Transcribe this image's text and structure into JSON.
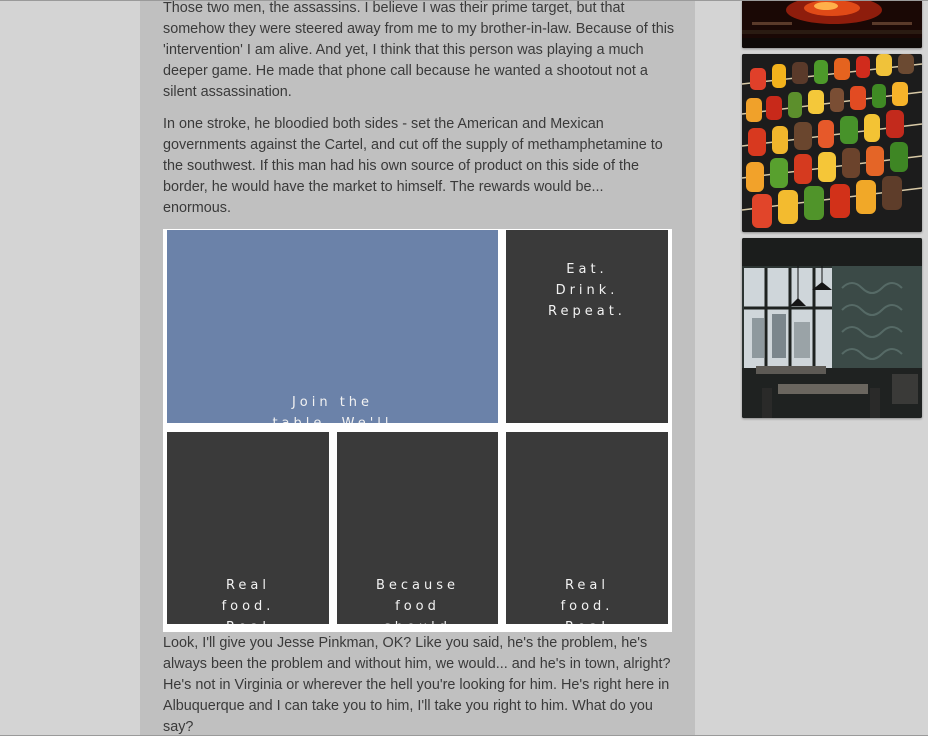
{
  "article": {
    "paragraphs": [
      "Those two men, the assassins. I believe I was their prime target, but that somehow they were steered away from me to my brother-in-law. Because of this 'intervention' I am alive. And yet, I think that this person was playing a much deeper game. He made that phone call because he wanted a shootout not a silent assassination.",
      "In one stroke, he bloodied both sides - set the American and Mexican governments against the Cartel, and cut off the supply of methamphetamine to the southwest. If this man had his own source of product on this side of the border, he would have the market to himself. The rewards would be... enormous.",
      "Look, I'll give you Jesse Pinkman, OK? Like you said, he's the problem, he's always been the problem and without him, we would... and he's in town, alright? He's not in Virginia or wherever the hell you're looking for him. He's right here in Albuquerque and I can take you to him, I'll take you right to him. What do you say?"
    ]
  },
  "ad_grid": {
    "tiles": [
      {
        "text": "Join the\ntable. We'll"
      },
      {
        "text": "Eat.\nDrink.\nRepeat."
      },
      {
        "text": "Real\nfood.\nReal"
      },
      {
        "text": "Because\nfood\nshould"
      },
      {
        "text": "Real\nfood.\nReal"
      }
    ]
  },
  "sidebar": {
    "thumbnails": [
      {
        "name": "fire-grill-photo"
      },
      {
        "name": "vegetable-skewers-photo"
      },
      {
        "name": "restaurant-interior-photo"
      }
    ]
  },
  "colors": {
    "page_bg": "#d4d4d4",
    "column_bg": "#c0c0c0",
    "text": "#3a3a3a",
    "tile_dark": "#3a3a3a",
    "tile_blue": "#6b82a9"
  }
}
